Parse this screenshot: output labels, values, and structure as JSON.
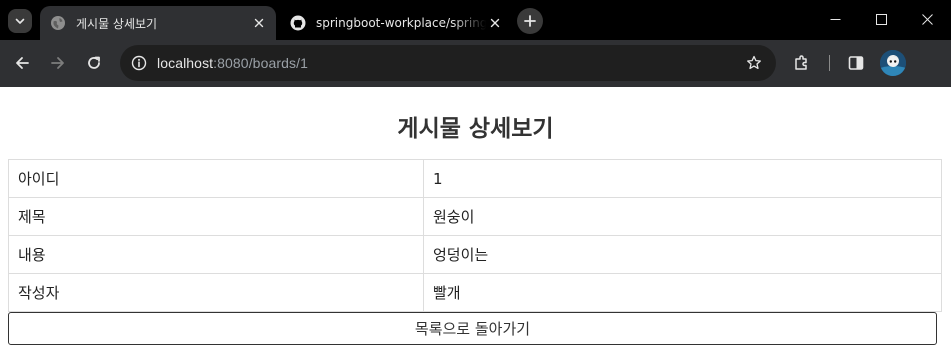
{
  "browser": {
    "tabs": [
      {
        "title": "게시물 상세보기",
        "favicon": "globe-icon",
        "active": true
      },
      {
        "title": "springboot-workplace/spring-b",
        "favicon": "github-icon",
        "active": false
      }
    ],
    "url_host": "localhost",
    "url_rest": ":8080/boards/1",
    "colors": {
      "tabstrip": "#000000",
      "toolbar": "#2f3033",
      "omnibox": "#1f1f1f"
    }
  },
  "page": {
    "title": "게시물 상세보기",
    "rows": [
      {
        "label": "아이디",
        "value": "1"
      },
      {
        "label": "제목",
        "value": "원숭이"
      },
      {
        "label": "내용",
        "value": "엉덩이는"
      },
      {
        "label": "작성자",
        "value": "빨개"
      }
    ],
    "back_button": "목록으로 돌아가기"
  }
}
